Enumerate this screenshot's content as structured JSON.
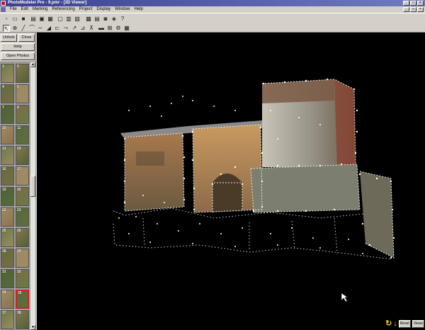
{
  "window": {
    "title": "PhotoModeler Pro - 9.pmr - [3D Viewer]",
    "controls": [
      "_",
      "□",
      "×"
    ]
  },
  "menu": {
    "items": [
      "File",
      "Edit",
      "Marking",
      "Referencing",
      "Project",
      "Display",
      "Window",
      "Help"
    ],
    "doc_controls": [
      "_",
      "□",
      "×"
    ]
  },
  "toolbar": {
    "icons": [
      "open-icon",
      "save-icon",
      "new-icon",
      "undo-icon",
      "copy-icon",
      "image-icon",
      "window-icon",
      "grid-icon",
      "mark-icon",
      "line-icon",
      "curve-icon",
      "surface-icon",
      "edge-icon",
      "reference-icon",
      "cylinder-icon",
      "point-icon",
      "table-icon",
      "zoom-icon",
      "camera-icon",
      "3d-viewer-icon"
    ]
  },
  "sidebar": {
    "unlock_label": "Unlock",
    "close_label": "Close",
    "help_label": "Help",
    "open_photos_label": "Open Photos",
    "thumbnails": [
      {
        "num": "1"
      },
      {
        "num": "2"
      },
      {
        "num": "4"
      },
      {
        "num": "5"
      },
      {
        "num": "7"
      },
      {
        "num": "8"
      },
      {
        "num": "10"
      },
      {
        "num": "11"
      },
      {
        "num": "13"
      },
      {
        "num": "14"
      },
      {
        "num": "16"
      },
      {
        "num": "17"
      },
      {
        "num": "19"
      },
      {
        "num": "20"
      },
      {
        "num": "22"
      },
      {
        "num": "23"
      },
      {
        "num": "25"
      },
      {
        "num": "26"
      },
      {
        "num": "28"
      },
      {
        "num": "29"
      },
      {
        "num": "31"
      },
      {
        "num": "32"
      },
      {
        "num": "34"
      },
      {
        "num": "35"
      },
      {
        "num": "37"
      },
      {
        "num": "38"
      }
    ],
    "selected_thumbnail": "35"
  },
  "viewer": {
    "background": "#000000",
    "nav_icons": [
      "rotate-icon",
      "move-down-icon",
      "pan-icon"
    ],
    "reset_label": "Reset",
    "views_label": "Views"
  },
  "colors": {
    "titlebar": "#3a3f8f",
    "nav_icon": "#f2d21a",
    "selection": "#d02020"
  }
}
